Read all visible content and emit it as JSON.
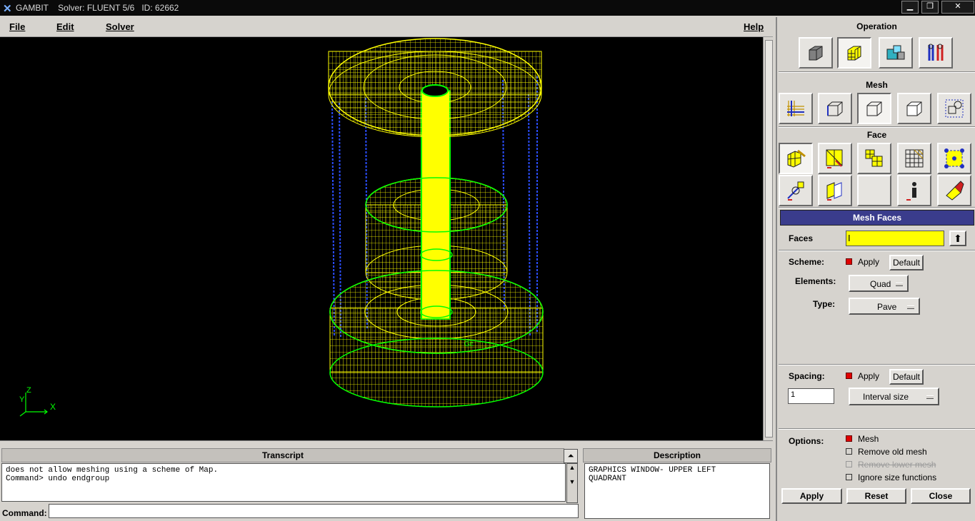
{
  "titlebar": {
    "app": "GAMBIT",
    "solver": "Solver: FLUENT 5/6",
    "id": "ID: 62662"
  },
  "menu": {
    "file": "File",
    "edit": "Edit",
    "solver": "Solver",
    "help": "Help"
  },
  "graphics": {
    "axis_z": "Z",
    "axis_y": "Y",
    "axis_x": "X",
    "mesh_color": "#ffff00",
    "edge_color": "#00ff00",
    "vertical_edge_color": "#1a4cff"
  },
  "transcript": {
    "header": "Transcript",
    "lines": "does not allow meshing using a scheme of Map.\nCommand> undo endgroup"
  },
  "description": {
    "header": "Description",
    "text": "GRAPHICS WINDOW- UPPER LEFT\nQUADRANT"
  },
  "command": {
    "label": "Command:",
    "value": ""
  },
  "panel": {
    "operation_title": "Operation",
    "mesh_title": "Mesh",
    "face_title": "Face",
    "operation_icons": [
      "geometry-icon",
      "mesh-icon",
      "zones-icon",
      "tools-icon"
    ],
    "mesh_icons": [
      "boundary-layer-icon",
      "edge-icon",
      "face-icon",
      "volume-icon",
      "group-icon"
    ],
    "face_icons_row1": [
      "mesh-faces-icon",
      "link-face-icon",
      "modify-face-icon",
      "smooth-face-icon",
      "face-vertex-icon"
    ],
    "face_icons_row2": [
      "split-face-icon",
      "connect-face-icon",
      "blank-icon",
      "summarize-icon",
      "erase-mesh-icon"
    ]
  },
  "form": {
    "title": "Mesh Faces",
    "faces_label": "Faces",
    "faces_value": "",
    "scheme_label": "Scheme:",
    "scheme_apply": "Apply",
    "scheme_default": "Default",
    "elements_label": "Elements:",
    "elements_value": "Quad",
    "type_label": "Type:",
    "type_value": "Pave",
    "spacing_label": "Spacing:",
    "spacing_apply": "Apply",
    "spacing_default": "Default",
    "spacing_value": "1",
    "spacing_mode": "Interval size",
    "options_label": "Options:",
    "opt_mesh": "Mesh",
    "opt_remove_old": "Remove old mesh",
    "opt_remove_lower": "Remove lower mesh",
    "opt_ignore_size": "Ignore size functions",
    "apply_button": "Apply",
    "reset_button": "Reset",
    "close_button": "Close"
  }
}
